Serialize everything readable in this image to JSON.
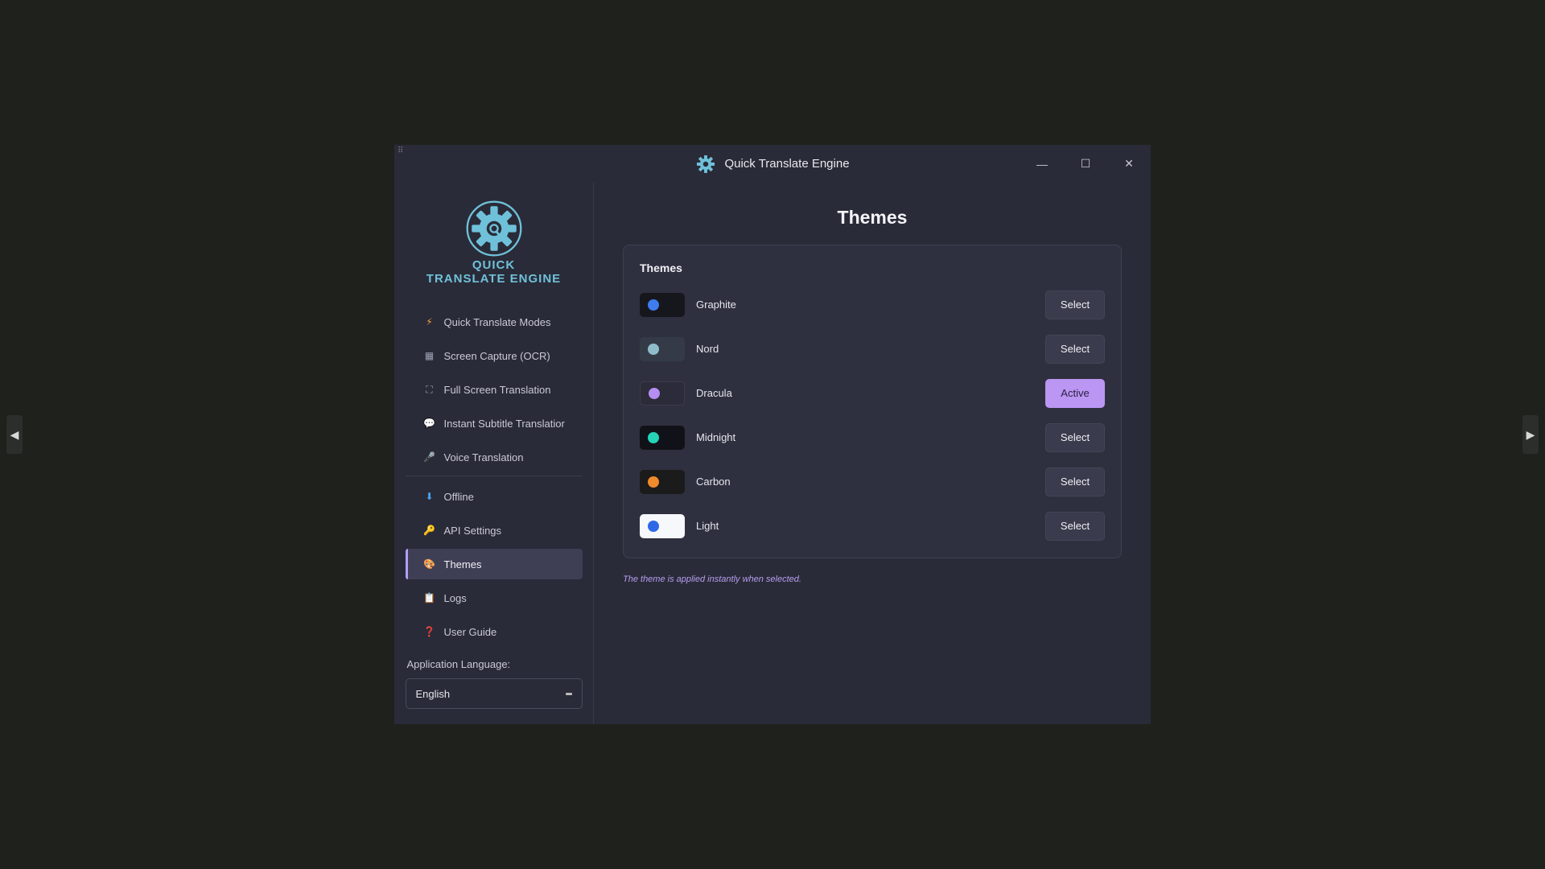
{
  "window": {
    "title": "Quick Translate Engine"
  },
  "logo": {
    "line1": "QUICK",
    "line2": "TRANSLATE ENGINE"
  },
  "sidebar": {
    "items": [
      {
        "label": "Quick Translate Modes",
        "icon": "⚡",
        "icon_name": "lightning-icon"
      },
      {
        "label": "Screen Capture (OCR)",
        "icon": "▦",
        "icon_name": "keyboard-icon"
      },
      {
        "label": "Full Screen Translation",
        "icon": "⛶",
        "icon_name": "fullscreen-icon"
      },
      {
        "label": "Instant Subtitle Translatior",
        "icon": "💬",
        "icon_name": "speech-bubble-icon"
      },
      {
        "label": "Voice Translation",
        "icon": "🎤",
        "icon_name": "microphone-icon"
      },
      {
        "label": "Offline",
        "icon": "⬇",
        "icon_name": "download-icon"
      },
      {
        "label": "API Settings",
        "icon": "🔑",
        "icon_name": "key-icon"
      },
      {
        "label": "Themes",
        "icon": "🎨",
        "icon_name": "palette-icon",
        "active": true
      },
      {
        "label": "Logs",
        "icon": "📋",
        "icon_name": "clipboard-icon"
      },
      {
        "label": "User Guide",
        "icon": "❓",
        "icon_name": "question-icon"
      }
    ],
    "language_label": "Application Language:",
    "language_value": "English"
  },
  "main": {
    "title": "Themes",
    "card_title": "Themes",
    "themes": [
      {
        "name": "Graphite",
        "swatch_bg": "#16171d",
        "dot": "#3e7cf0",
        "button": "Select"
      },
      {
        "name": "Nord",
        "swatch_bg": "#343b47",
        "dot": "#8fbcca",
        "button": "Select"
      },
      {
        "name": "Dracula",
        "swatch_bg": "#2b2b3a",
        "dot": "#b68ef1",
        "button": "Active",
        "active": true
      },
      {
        "name": "Midnight",
        "swatch_bg": "#111219",
        "dot": "#25d3b6",
        "button": "Select"
      },
      {
        "name": "Carbon",
        "swatch_bg": "#1b1b1b",
        "dot": "#f08a2c",
        "button": "Select"
      },
      {
        "name": "Light",
        "swatch_bg": "#f7f8fb",
        "dot": "#2f68e6",
        "button": "Select"
      }
    ],
    "hint": "The theme is applied instantly when selected."
  },
  "colors": {
    "accent": "#bb96f3",
    "logo": "#6fc1da",
    "window_bg": "#2a2b38",
    "desktop_bg": "#1f211d"
  }
}
